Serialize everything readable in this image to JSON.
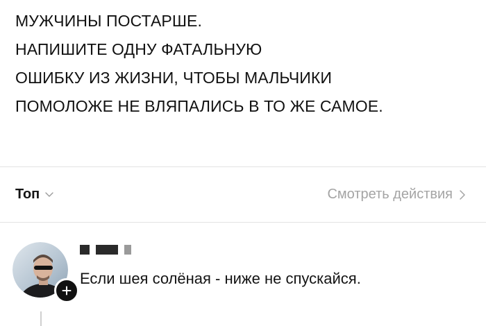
{
  "post": {
    "lines": [
      "МУЖЧИНЫ ПОСТАРШЕ.",
      "НАПИШИТЕ ОДНУ ФАТАЛЬНУЮ",
      "ОШИБКУ ИЗ ЖИЗНИ, ЧТОБЫ МАЛЬЧИКИ",
      "ПОМОЛОЖЕ НЕ ВЛЯПАЛИСЬ В ТО ЖЕ САМОЕ."
    ]
  },
  "sort": {
    "label": "Топ",
    "icon": "chevron-down-icon"
  },
  "activity": {
    "label": "Смотреть действия",
    "icon": "chevron-right-icon"
  },
  "comment": {
    "text": "Если шея солёная - ниже не спускайся.",
    "avatar_icon": "user-avatar",
    "follow_icon": "plus-icon"
  },
  "colors": {
    "text_primary": "#141414",
    "text_muted": "#a4a4a4",
    "divider": "#e3e3e3",
    "badge": "#111111"
  }
}
